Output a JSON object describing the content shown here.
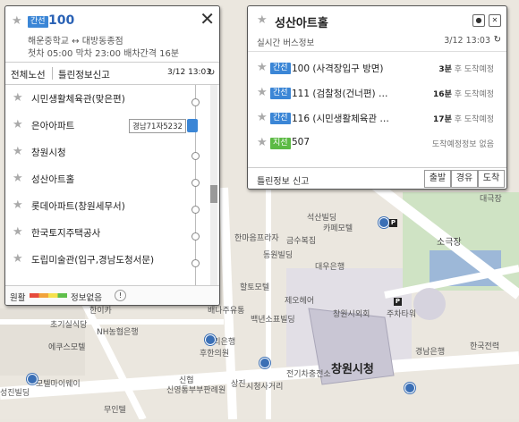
{
  "map": {
    "labels": [
      "초기실식당",
      "에쿠스모텔",
      "모텔마이웨이",
      "성진빌딩",
      "NH농협은행",
      "신협",
      "신영통부부판례원",
      "무인텔",
      "우리은행",
      "후한의원",
      "한이카",
      "배나주유통",
      "상진",
      "석산빌딩",
      "카페모텔",
      "금수복집",
      "한마음프라자",
      "동원빌딩",
      "대우은행",
      "할토모텔",
      "제오헤어",
      "백년소표빌딩",
      "창원시외회",
      "주차타워",
      "경남은행",
      "전기차충전소",
      "창원시청",
      "소극장",
      "한국전력",
      "대극장",
      "시청사거리"
    ]
  },
  "left_panel": {
    "badge": "간선",
    "route_number": "100",
    "close": "✕",
    "endpoints": "해운중학교 ↔ 대방동종점",
    "schedule": "첫차 05:00   막차 23:00   배차간격 16분",
    "tabs": [
      "전체노선",
      "틀린정보신고"
    ],
    "timestamp": "3/12 13:03",
    "stops": [
      "시민생활체육관(맞은편)",
      "은아아파트",
      "창원시청",
      "성산아트홀",
      "롯데아파트(창원세무서)",
      "한국토지주택공사",
      "도립미술관(입구,경남도청서문)"
    ],
    "bus_tip": "경남71자5232",
    "footer_left": "원활",
    "footer_right": "정보없음"
  },
  "right_panel": {
    "title": "성산아트홀",
    "subtitle": "실시간 버스정보",
    "timestamp": "3/12 13:03",
    "routes": [
      {
        "type": "간선",
        "color": "#3b86d6",
        "name": "100 (사격장입구 방면)",
        "eta_num": "3분",
        "eta_txt": "후 도착예정"
      },
      {
        "type": "간선",
        "color": "#3b86d6",
        "name": "111 (검찰청(건너편) …",
        "eta_num": "16분",
        "eta_txt": "후 도착예정"
      },
      {
        "type": "간선",
        "color": "#3b86d6",
        "name": "116 (시민생활체육관 …",
        "eta_num": "17분",
        "eta_txt": "후 도착예정"
      },
      {
        "type": "지선",
        "color": "#5cba44",
        "name": "507",
        "eta_num": "",
        "eta_txt": "도착예정정보 없음"
      }
    ],
    "report": "틀린정보 신고",
    "buttons": [
      "출발",
      "경유",
      "도착"
    ]
  }
}
